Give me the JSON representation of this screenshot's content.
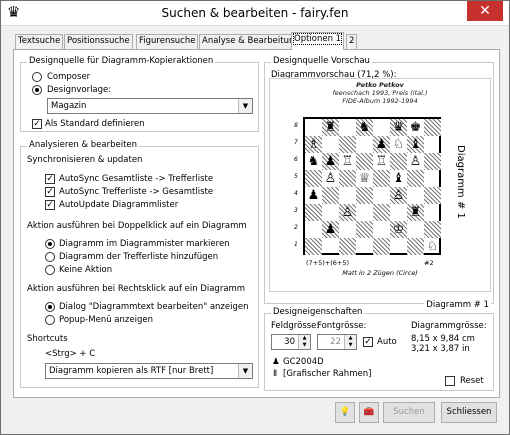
{
  "window": {
    "title": "Suchen & bearbeiten - fairy.fen",
    "app_icon": "♛",
    "close_glyph": "✕"
  },
  "tabs": [
    {
      "label": "Textsuche"
    },
    {
      "label": "Positionssuche"
    },
    {
      "label": "Figurensuche"
    },
    {
      "label": "Analyse &  Bearbeitung"
    },
    {
      "label": "Optionen 1"
    },
    {
      "label": "2"
    }
  ],
  "designquelle": {
    "title": "Designquelle für Diagramm-Kopieraktionen",
    "composer": "Composer",
    "designvorlage": "Designvorlage:",
    "template_value": "Magazin",
    "default_label": "Als Standard definieren",
    "default_checked": true
  },
  "analysieren": {
    "title": "Analysieren & bearbeiten",
    "sync_heading": "Synchronisieren & updaten",
    "autosync1": "AutoSync Gesamtliste -> Trefferliste",
    "autosync2": "AutoSync Trefferliste -> Gesamtliste",
    "autoupdate": "AutoUpdate Diagrammlister",
    "dbl_heading": "Aktion ausführen bei Doppelklick auf ein Diagramm",
    "dbl_opt1": "Diagramm im Diagrammister markieren",
    "dbl_opt2": "Diagramm der Trefferliste hinzufügen",
    "dbl_opt3": "Keine Aktion",
    "right_heading": "Aktion ausführen bei Rechtsklick auf ein Diagramm",
    "right_opt1": "Dialog \"Diagrammtext bearbeiten\" anzeigen",
    "right_opt2": "Popup-Menü anzeigen",
    "shortcuts_heading": "Shortcuts",
    "shortcut_key": "<Strg> + C",
    "shortcut_value": "Diagramm kopieren als RTF [nur Brett]"
  },
  "vorschau": {
    "title": "Designquelle Vorschau",
    "label": "Diagrammvorschau (71,2 %):",
    "hdr1": "Petko Petkov",
    "hdr2": "feenschach 1993, Preis (ital.)",
    "hdr3": "FIDE-Album 1992-1994",
    "files_left": "(7+5)+(6+5)",
    "files_right": "#2",
    "stipulation": "Matt in 2 Zügen (Circe)",
    "side_label": "Diagramm # 1",
    "bottom_label": "Diagramm # 1",
    "ranks": [
      "8",
      "7",
      "6",
      "5",
      "4",
      "3",
      "2",
      "1"
    ]
  },
  "board": {
    "pieces": [
      {
        "r": 0,
        "c": 1,
        "g": "♜"
      },
      {
        "r": 0,
        "c": 3,
        "g": "♞"
      },
      {
        "r": 0,
        "c": 5,
        "g": "♛"
      },
      {
        "r": 0,
        "c": 6,
        "g": "♚"
      },
      {
        "r": 1,
        "c": 0,
        "g": "♗"
      },
      {
        "r": 1,
        "c": 4,
        "g": "♟"
      },
      {
        "r": 1,
        "c": 5,
        "g": "♘"
      },
      {
        "r": 1,
        "c": 6,
        "g": "♝"
      },
      {
        "r": 2,
        "c": 0,
        "g": "♞"
      },
      {
        "r": 2,
        "c": 1,
        "g": "♟"
      },
      {
        "r": 2,
        "c": 2,
        "g": "♖"
      },
      {
        "r": 2,
        "c": 4,
        "g": "♖"
      },
      {
        "r": 2,
        "c": 6,
        "g": "♙"
      },
      {
        "r": 3,
        "c": 1,
        "g": "♙"
      },
      {
        "r": 3,
        "c": 3,
        "g": "♕"
      },
      {
        "r": 3,
        "c": 5,
        "g": "♝"
      },
      {
        "r": 4,
        "c": 0,
        "g": "♟"
      },
      {
        "r": 4,
        "c": 5,
        "g": "♙"
      },
      {
        "r": 5,
        "c": 2,
        "g": "♙"
      },
      {
        "r": 5,
        "c": 6,
        "g": "♜"
      },
      {
        "r": 6,
        "c": 1,
        "g": "♟"
      },
      {
        "r": 6,
        "c": 5,
        "g": "♔"
      },
      {
        "r": 7,
        "c": 7,
        "g": "♘"
      }
    ]
  },
  "eigenschaften": {
    "title": "Designeigenschaften",
    "feldgroesse_label": "Feldgrösse:",
    "feldgroesse_value": "30",
    "fontgroesse_label": "Fontgrösse:",
    "fontgroesse_value": "22",
    "auto_label": "Auto",
    "diagrammgroesse_label": "Diagrammgrösse:",
    "size_cm": "8,15 x 9,84 cm",
    "size_in": "3,21 x 3,87 in",
    "font_name": "GC2004D",
    "frame": "[Grafischer Rahmen]",
    "reset": "Reset"
  },
  "buttons": {
    "search": "Suchen",
    "close": "Schliessen"
  }
}
